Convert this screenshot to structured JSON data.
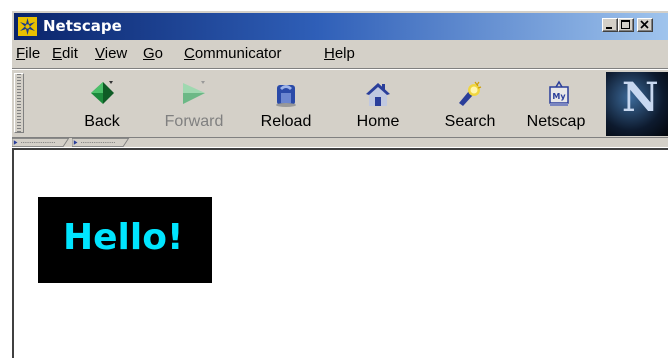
{
  "window": {
    "title": "Netscape",
    "icon": "netscape-app-icon"
  },
  "menubar": {
    "items": [
      {
        "label_ul": "F",
        "label_rest": "ile"
      },
      {
        "label_ul": "E",
        "label_rest": "dit"
      },
      {
        "label_ul": "V",
        "label_rest": "iew"
      },
      {
        "label_ul": "G",
        "label_rest": "o"
      },
      {
        "label_ul": "C",
        "label_rest": "ommunicator"
      },
      {
        "label_ul": "H",
        "label_rest": "elp"
      }
    ]
  },
  "toolbar": {
    "buttons": [
      {
        "label": "Back",
        "icon": "back-arrow-icon",
        "enabled": true
      },
      {
        "label": "Forward",
        "icon": "forward-arrow-icon",
        "enabled": false
      },
      {
        "label": "Reload",
        "icon": "reload-icon",
        "enabled": true
      },
      {
        "label": "Home",
        "icon": "home-icon",
        "enabled": true
      },
      {
        "label": "Search",
        "icon": "search-icon",
        "enabled": true
      },
      {
        "label": "Netscap",
        "icon": "my-netscape-icon",
        "enabled": true
      }
    ],
    "logo_letter": "N"
  },
  "content": {
    "banner_text": "Hello!",
    "banner_bg": "#000000",
    "banner_fg": "#00e5ff"
  },
  "colors": {
    "titlebar_start": "#0a246a",
    "titlebar_end": "#a6caf0",
    "chrome": "#d4d0c8"
  }
}
